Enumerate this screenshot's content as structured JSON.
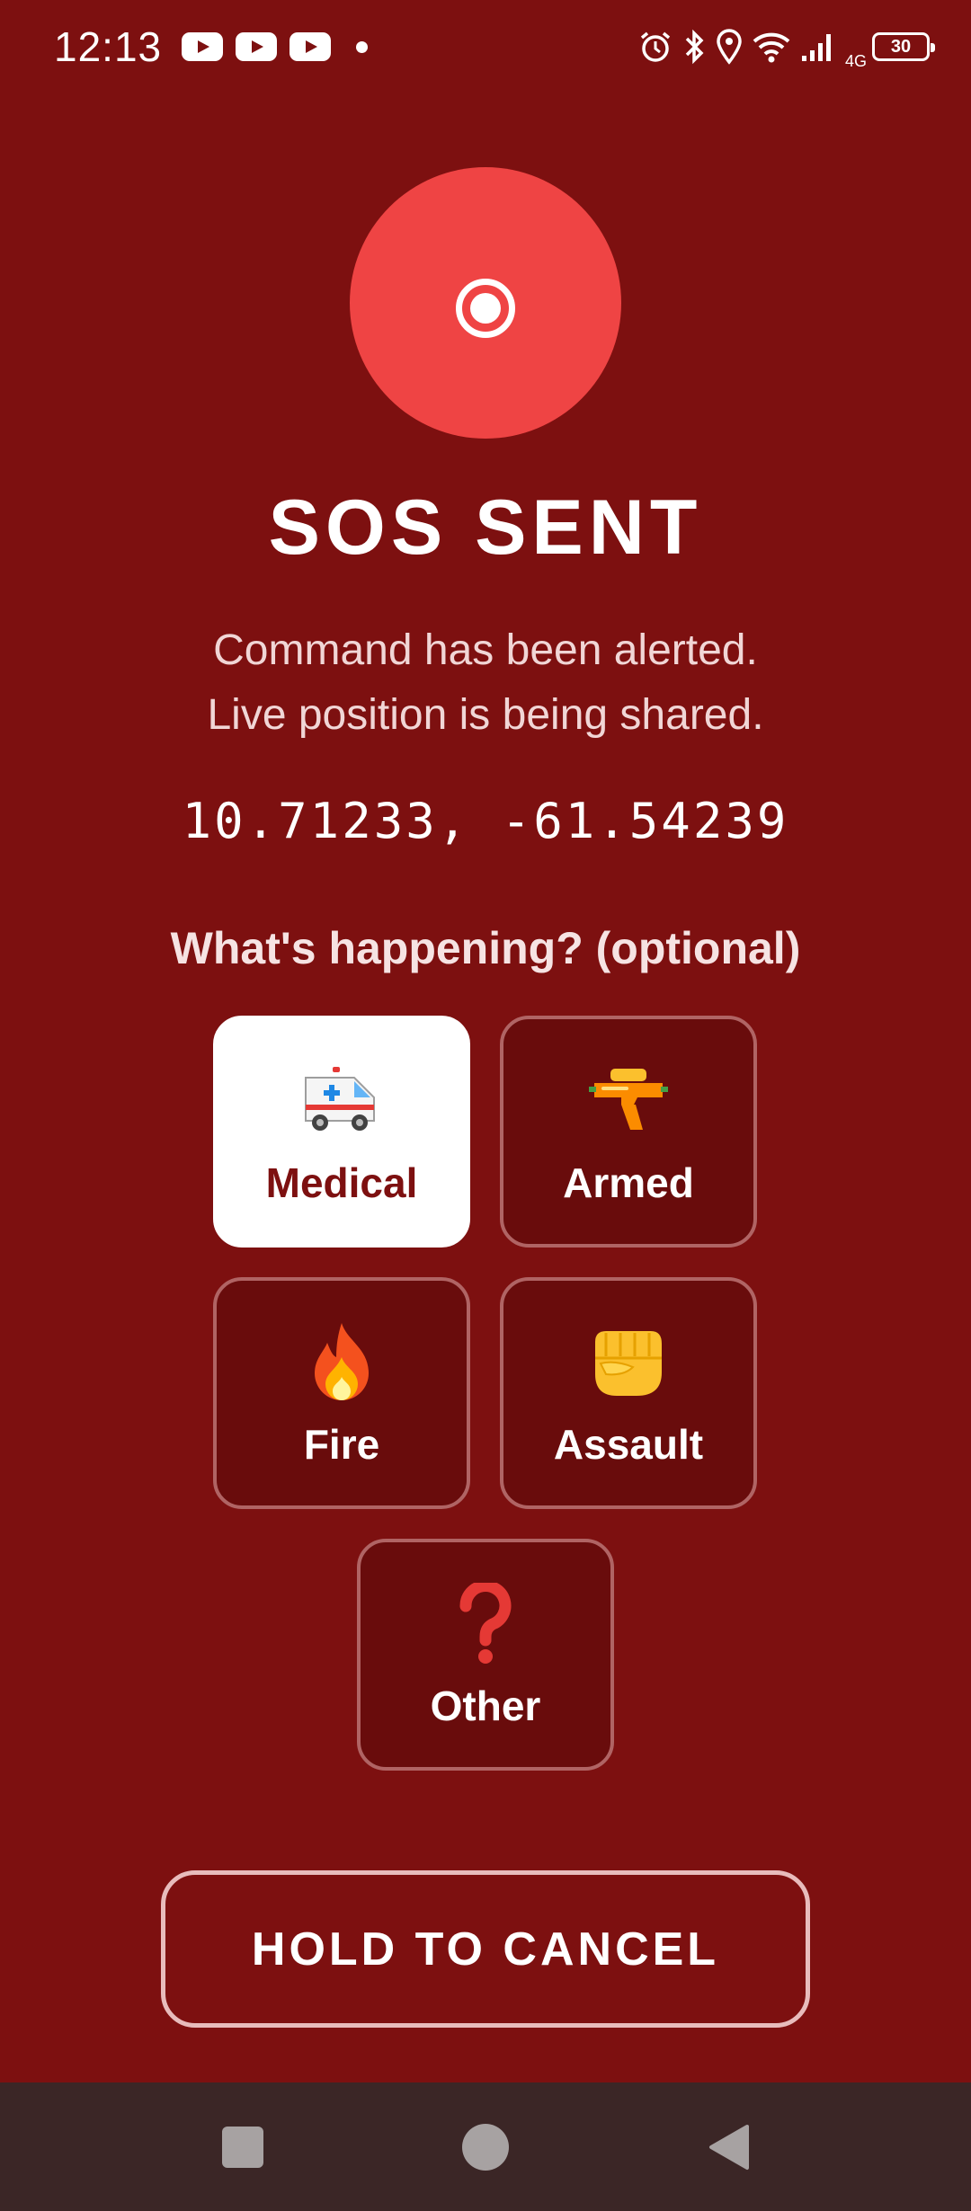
{
  "status_bar": {
    "time": "12:13",
    "network": "4G",
    "battery": "30",
    "notification_icons": [
      "youtube-icon",
      "youtube-icon",
      "youtube-icon"
    ],
    "system_icons": [
      "alarm-icon",
      "bluetooth-icon",
      "location-icon",
      "wifi-icon",
      "signal-icon",
      "battery-icon"
    ]
  },
  "sos": {
    "icon": "record-icon",
    "accent_color": "#ef4444",
    "title": "SOS SENT",
    "message_line1": "Command has been alerted.",
    "message_line2": "Live position is being shared.",
    "coordinates": "10.71233, -61.54239"
  },
  "incident": {
    "question": "What's happening?  (optional)",
    "options": [
      {
        "label": "Medical",
        "icon": "ambulance-icon",
        "selected": true
      },
      {
        "label": "Armed",
        "icon": "water-gun-icon",
        "selected": false
      },
      {
        "label": "Fire",
        "icon": "fire-icon",
        "selected": false
      },
      {
        "label": "Assault",
        "icon": "fist-icon",
        "selected": false
      },
      {
        "label": "Other",
        "icon": "question-mark-icon",
        "selected": false
      }
    ]
  },
  "cancel": {
    "label": "HOLD TO CANCEL"
  },
  "nav": {
    "buttons": [
      "recents-icon",
      "home-icon",
      "back-icon"
    ]
  },
  "colors": {
    "background": "#7d1010",
    "option_background": "#690c0c",
    "selected_background": "#ffffff"
  }
}
